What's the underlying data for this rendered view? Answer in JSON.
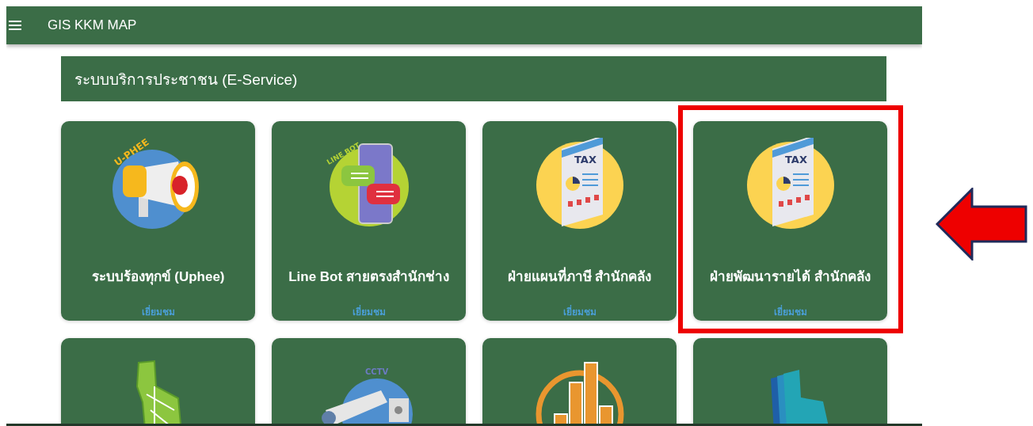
{
  "app_bar": {
    "title": "GIS KKM MAP"
  },
  "section": {
    "title": "ระบบบริการประชาชน (E-Service)"
  },
  "cards": [
    {
      "kind": "megaphone",
      "art_text": "U-PHEE",
      "title": "ระบบร้องทุกข์ (Uphee)",
      "link": "เยี่ยมชม",
      "highlighted": false
    },
    {
      "kind": "chatbot",
      "art_text": "LINE BOT",
      "title": "Line Bot สายตรงสำนักช่าง",
      "link": "เยี่ยมชม",
      "highlighted": false
    },
    {
      "kind": "tax",
      "art_text": "TAX",
      "title": "ฝ่ายแผนที่ภาษี สำนักคลัง",
      "link": "เยี่ยมชม",
      "highlighted": false
    },
    {
      "kind": "tax",
      "art_text": "TAX",
      "title": "ฝ่ายพัฒนารายได้ สำนักคลัง",
      "link": "เยี่ยมชม",
      "highlighted": true
    },
    {
      "kind": "map",
      "highlighted": false
    },
    {
      "kind": "cctv",
      "art_text": "CCTV",
      "highlighted": false
    },
    {
      "kind": "chart",
      "highlighted": false
    },
    {
      "kind": "layers",
      "highlighted": false
    }
  ]
}
